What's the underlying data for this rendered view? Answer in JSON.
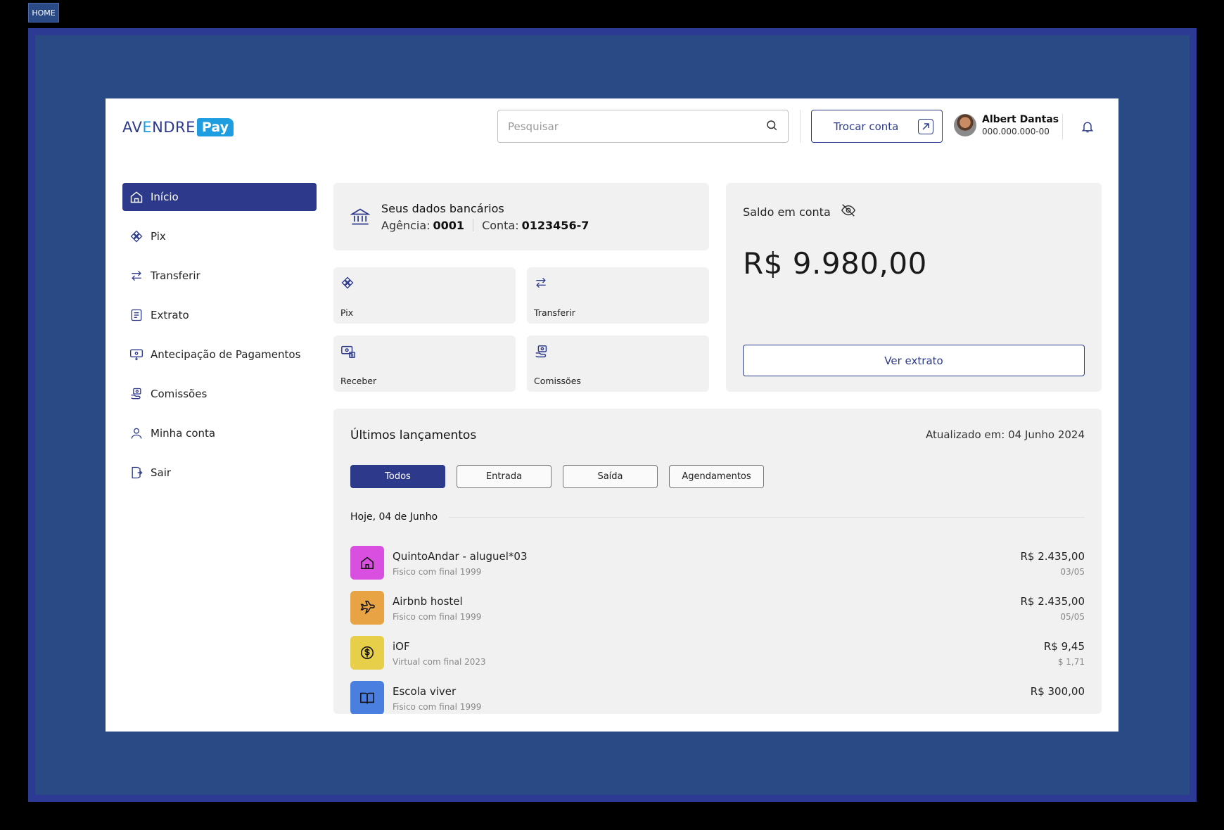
{
  "home_tag": "HOME",
  "logo": {
    "text_a": "AV",
    "text_e": "E",
    "text_b": "NDRE",
    "pay": "Pay"
  },
  "search": {
    "placeholder": "Pesquisar"
  },
  "header": {
    "switch_label": "Trocar conta"
  },
  "user": {
    "name": "Albert Dantas",
    "doc": "000.000.000-00"
  },
  "sidebar": {
    "items": [
      {
        "label": "Início",
        "icon": "home-icon",
        "active": true
      },
      {
        "label": "Pix",
        "icon": "pix-icon"
      },
      {
        "label": "Transferir",
        "icon": "transfer-icon"
      },
      {
        "label": "Extrato",
        "icon": "statement-icon"
      },
      {
        "label": "Antecipação de Pagamentos",
        "icon": "advance-icon"
      },
      {
        "label": "Comissões",
        "icon": "commission-icon"
      },
      {
        "label": "Minha conta",
        "icon": "user-icon"
      },
      {
        "label": "Sair",
        "icon": "logout-icon"
      }
    ]
  },
  "bank": {
    "title": "Seus dados bancários",
    "agency_label": "Agência:",
    "agency_value": "0001",
    "account_label": "Conta:",
    "account_value": "0123456-7"
  },
  "quick_actions": [
    {
      "label": "Pix",
      "icon": "pix-icon"
    },
    {
      "label": "Transferir",
      "icon": "transfer-icon"
    },
    {
      "label": "Receber",
      "icon": "receive-icon"
    },
    {
      "label": "Comissões",
      "icon": "commission-icon"
    }
  ],
  "balance": {
    "title": "Saldo em conta",
    "value": "R$ 9.980,00",
    "button": "Ver extrato"
  },
  "launches": {
    "title": "Últimos lançamentos",
    "updated": "Atualizado em: 04 Junho 2024",
    "filters": [
      "Todos",
      "Entrada",
      "Saída",
      "Agendamentos"
    ],
    "active_filter": "Todos",
    "day": "Hoje, 04 de Junho",
    "items": [
      {
        "name": "QuintoAndar - aluguel*03",
        "sub": "Fisico com final 1999",
        "amount": "R$ 2.435,00",
        "date": "03/05",
        "color": "#d94fe0",
        "icon": "house-icon"
      },
      {
        "name": "Airbnb hostel",
        "sub": "Fisico com final 1999",
        "amount": "R$ 2.435,00",
        "date": "05/05",
        "color": "#e8a444",
        "icon": "plane-icon"
      },
      {
        "name": "iOF",
        "sub": "Virtual com final 2023",
        "amount": "R$ 9,45",
        "date": "$ 1,71",
        "color": "#e8cf4a",
        "icon": "dollar-icon"
      },
      {
        "name": "Escola viver",
        "sub": "Fisico com final 1999",
        "amount": "R$ 300,00",
        "date": "",
        "color": "#4a7fe0",
        "icon": "book-icon"
      }
    ]
  },
  "colors": {
    "primary": "#2d3a8c",
    "accent": "#1e9ee0",
    "frame": "#2a4a86",
    "card": "#f1f1f1"
  }
}
